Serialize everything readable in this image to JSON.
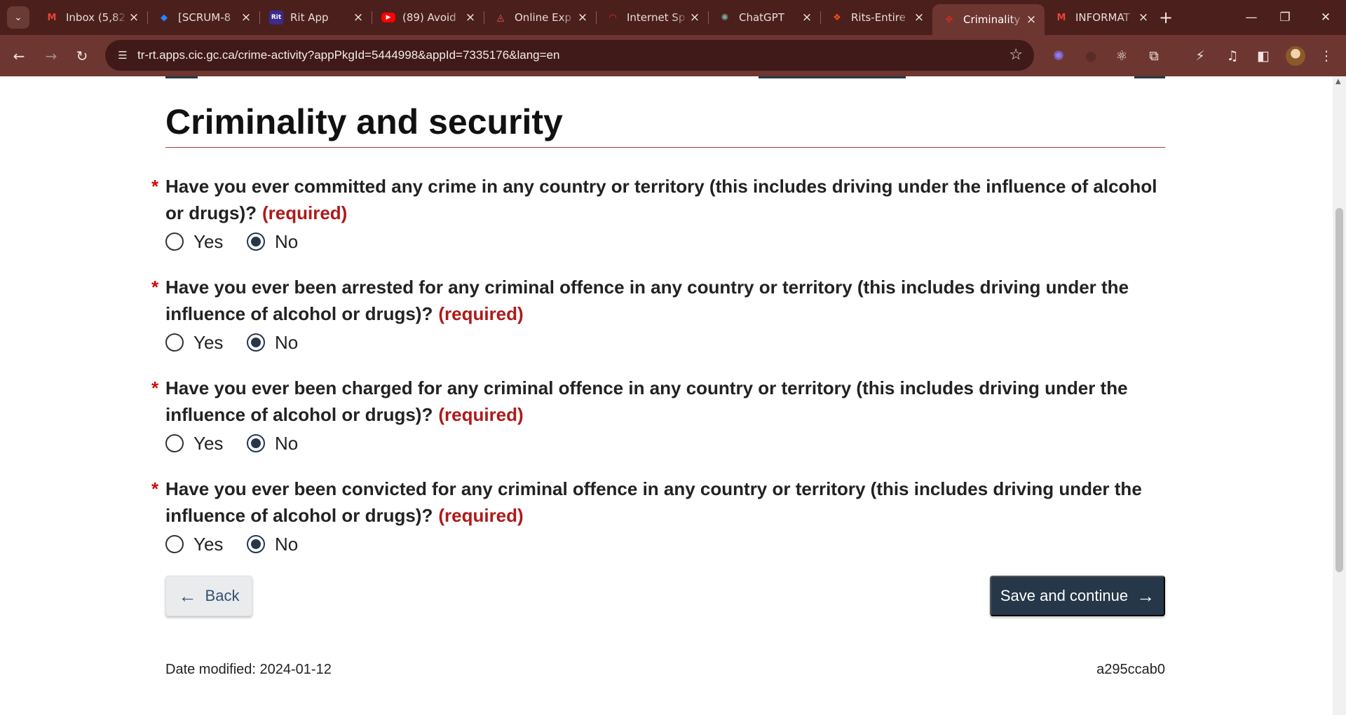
{
  "browser": {
    "tab_list_icon": "chevron-down-icon",
    "tabs": [
      {
        "label": "Inbox (5,82",
        "icon": "gmail-icon",
        "icon_color": "#ea4335"
      },
      {
        "label": "[SCRUM-8",
        "icon": "jira-icon",
        "icon_color": "#2684ff"
      },
      {
        "label": "Rit App",
        "icon": "rit-app-icon",
        "icon_color": "#3a2b8c"
      },
      {
        "label": "(89) Avoid",
        "icon": "youtube-icon",
        "icon_color": "#ff0000"
      },
      {
        "label": "Online Exp",
        "icon": "airbnb-icon",
        "icon_color": "#ff5a5f"
      },
      {
        "label": "Internet Sp",
        "icon": "speedtest-icon",
        "icon_color": "#e0312b"
      },
      {
        "label": "ChatGPT",
        "icon": "chatgpt-icon",
        "icon_color": "#74aa9c"
      },
      {
        "label": "Rits-Entire",
        "icon": "figma-icon",
        "icon_color": "#f24e1e"
      },
      {
        "label": "Criminality",
        "icon": "maple-leaf-icon",
        "icon_color": "#d52b1e",
        "active": true
      },
      {
        "label": "INFORMAT",
        "icon": "gmail-icon",
        "icon_color": "#ea4335"
      }
    ],
    "new_tab_label": "+",
    "url": "tr-rt.apps.cic.gc.ca/crime-activity?appPkgId=5444998&appId=7335176&lang=en"
  },
  "page": {
    "title": "Criminality and security",
    "accent_color": "#af3c43",
    "required_label": "(required)",
    "questions": [
      {
        "text": "Have you ever committed any crime in any country or territory (this includes driving under the influence of alcohol or drugs)?",
        "yes_label": "Yes",
        "no_label": "No",
        "selected": "No"
      },
      {
        "text": "Have you ever been arrested for any criminal offence in any country or territory (this includes driving under the influence of alcohol or drugs)?",
        "yes_label": "Yes",
        "no_label": "No",
        "selected": "No"
      },
      {
        "text": "Have you ever been charged for any criminal offence in any country or territory (this includes driving under the influence of alcohol or drugs)?",
        "yes_label": "Yes",
        "no_label": "No",
        "selected": "No"
      },
      {
        "text": "Have you ever been convicted for any criminal offence in any country or territory (this includes driving under the influence of alcohol or drugs)?",
        "yes_label": "Yes",
        "no_label": "No",
        "selected": "No"
      }
    ],
    "back_label": "Back",
    "save_label": "Save and continue",
    "primary_color": "#26374a"
  },
  "footer": {
    "date_modified": "Date modified: 2024-01-12",
    "build_id": "a295ccab0"
  }
}
